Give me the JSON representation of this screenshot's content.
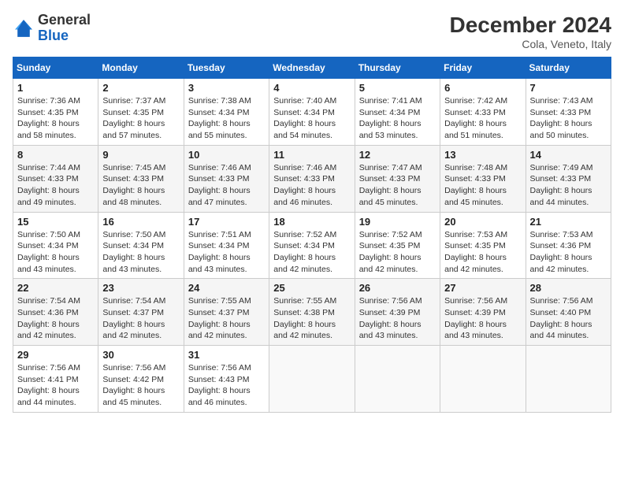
{
  "logo": {
    "general": "General",
    "blue": "Blue"
  },
  "title": "December 2024",
  "location": "Cola, Veneto, Italy",
  "days_of_week": [
    "Sunday",
    "Monday",
    "Tuesday",
    "Wednesday",
    "Thursday",
    "Friday",
    "Saturday"
  ],
  "weeks": [
    [
      {
        "day": "1",
        "sunrise": "7:36 AM",
        "sunset": "4:35 PM",
        "daylight": "8 hours and 58 minutes."
      },
      {
        "day": "2",
        "sunrise": "7:37 AM",
        "sunset": "4:35 PM",
        "daylight": "8 hours and 57 minutes."
      },
      {
        "day": "3",
        "sunrise": "7:38 AM",
        "sunset": "4:34 PM",
        "daylight": "8 hours and 55 minutes."
      },
      {
        "day": "4",
        "sunrise": "7:40 AM",
        "sunset": "4:34 PM",
        "daylight": "8 hours and 54 minutes."
      },
      {
        "day": "5",
        "sunrise": "7:41 AM",
        "sunset": "4:34 PM",
        "daylight": "8 hours and 53 minutes."
      },
      {
        "day": "6",
        "sunrise": "7:42 AM",
        "sunset": "4:33 PM",
        "daylight": "8 hours and 51 minutes."
      },
      {
        "day": "7",
        "sunrise": "7:43 AM",
        "sunset": "4:33 PM",
        "daylight": "8 hours and 50 minutes."
      }
    ],
    [
      {
        "day": "8",
        "sunrise": "7:44 AM",
        "sunset": "4:33 PM",
        "daylight": "8 hours and 49 minutes."
      },
      {
        "day": "9",
        "sunrise": "7:45 AM",
        "sunset": "4:33 PM",
        "daylight": "8 hours and 48 minutes."
      },
      {
        "day": "10",
        "sunrise": "7:46 AM",
        "sunset": "4:33 PM",
        "daylight": "8 hours and 47 minutes."
      },
      {
        "day": "11",
        "sunrise": "7:46 AM",
        "sunset": "4:33 PM",
        "daylight": "8 hours and 46 minutes."
      },
      {
        "day": "12",
        "sunrise": "7:47 AM",
        "sunset": "4:33 PM",
        "daylight": "8 hours and 45 minutes."
      },
      {
        "day": "13",
        "sunrise": "7:48 AM",
        "sunset": "4:33 PM",
        "daylight": "8 hours and 45 minutes."
      },
      {
        "day": "14",
        "sunrise": "7:49 AM",
        "sunset": "4:33 PM",
        "daylight": "8 hours and 44 minutes."
      }
    ],
    [
      {
        "day": "15",
        "sunrise": "7:50 AM",
        "sunset": "4:34 PM",
        "daylight": "8 hours and 43 minutes."
      },
      {
        "day": "16",
        "sunrise": "7:50 AM",
        "sunset": "4:34 PM",
        "daylight": "8 hours and 43 minutes."
      },
      {
        "day": "17",
        "sunrise": "7:51 AM",
        "sunset": "4:34 PM",
        "daylight": "8 hours and 43 minutes."
      },
      {
        "day": "18",
        "sunrise": "7:52 AM",
        "sunset": "4:34 PM",
        "daylight": "8 hours and 42 minutes."
      },
      {
        "day": "19",
        "sunrise": "7:52 AM",
        "sunset": "4:35 PM",
        "daylight": "8 hours and 42 minutes."
      },
      {
        "day": "20",
        "sunrise": "7:53 AM",
        "sunset": "4:35 PM",
        "daylight": "8 hours and 42 minutes."
      },
      {
        "day": "21",
        "sunrise": "7:53 AM",
        "sunset": "4:36 PM",
        "daylight": "8 hours and 42 minutes."
      }
    ],
    [
      {
        "day": "22",
        "sunrise": "7:54 AM",
        "sunset": "4:36 PM",
        "daylight": "8 hours and 42 minutes."
      },
      {
        "day": "23",
        "sunrise": "7:54 AM",
        "sunset": "4:37 PM",
        "daylight": "8 hours and 42 minutes."
      },
      {
        "day": "24",
        "sunrise": "7:55 AM",
        "sunset": "4:37 PM",
        "daylight": "8 hours and 42 minutes."
      },
      {
        "day": "25",
        "sunrise": "7:55 AM",
        "sunset": "4:38 PM",
        "daylight": "8 hours and 42 minutes."
      },
      {
        "day": "26",
        "sunrise": "7:56 AM",
        "sunset": "4:39 PM",
        "daylight": "8 hours and 43 minutes."
      },
      {
        "day": "27",
        "sunrise": "7:56 AM",
        "sunset": "4:39 PM",
        "daylight": "8 hours and 43 minutes."
      },
      {
        "day": "28",
        "sunrise": "7:56 AM",
        "sunset": "4:40 PM",
        "daylight": "8 hours and 44 minutes."
      }
    ],
    [
      {
        "day": "29",
        "sunrise": "7:56 AM",
        "sunset": "4:41 PM",
        "daylight": "8 hours and 44 minutes."
      },
      {
        "day": "30",
        "sunrise": "7:56 AM",
        "sunset": "4:42 PM",
        "daylight": "8 hours and 45 minutes."
      },
      {
        "day": "31",
        "sunrise": "7:56 AM",
        "sunset": "4:43 PM",
        "daylight": "8 hours and 46 minutes."
      },
      null,
      null,
      null,
      null
    ]
  ],
  "labels": {
    "sunrise": "Sunrise:",
    "sunset": "Sunset:",
    "daylight": "Daylight:"
  }
}
